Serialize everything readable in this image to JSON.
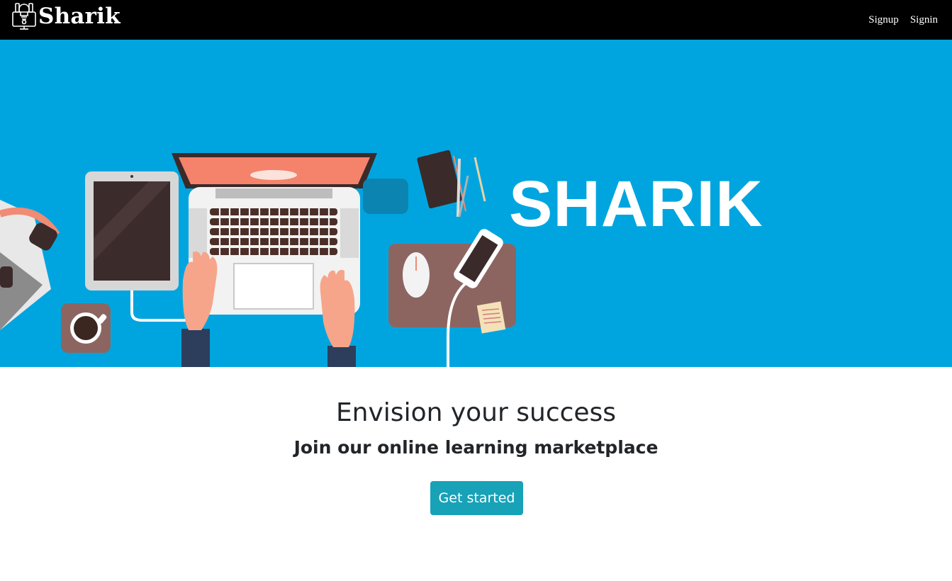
{
  "navbar": {
    "brand_name": "Sharik",
    "links": [
      {
        "label": "Signup"
      },
      {
        "label": "Signin"
      }
    ],
    "logo_icon": "lightbulb-computer-logo-icon"
  },
  "hero": {
    "title": "SHARIK",
    "background_color": "#00a5df",
    "illustration": "desk-workspace-illustration"
  },
  "main": {
    "headline": "Envision your success",
    "subheadline": "Join our online learning marketplace",
    "cta_label": "Get started",
    "cta_color": "#17a2b8"
  }
}
